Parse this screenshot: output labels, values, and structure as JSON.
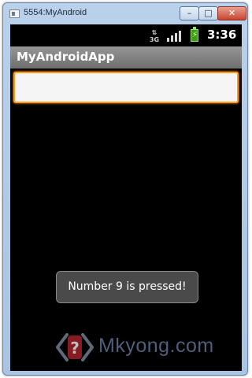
{
  "window": {
    "title": "5554:MyAndroid",
    "minimize_symbol": "–",
    "maximize_symbol": "□",
    "close_symbol": "✕"
  },
  "status_bar": {
    "network_type": "3G",
    "time": "3:36",
    "icons": [
      "network-3g-icon",
      "signal-strength-icon",
      "battery-charging-icon"
    ]
  },
  "app": {
    "title": "MyAndroidApp",
    "edit_text_value": ""
  },
  "toast": {
    "message": "Number 9 is pressed!"
  },
  "watermark": {
    "text": "Mkyong.com"
  },
  "colors": {
    "focus_border": "#ff9a1a",
    "app_title_bar": "#7f7f7f",
    "screen_background": "#000000",
    "battery": "#3c9f1b",
    "toast_background": "#4a4a4a"
  }
}
